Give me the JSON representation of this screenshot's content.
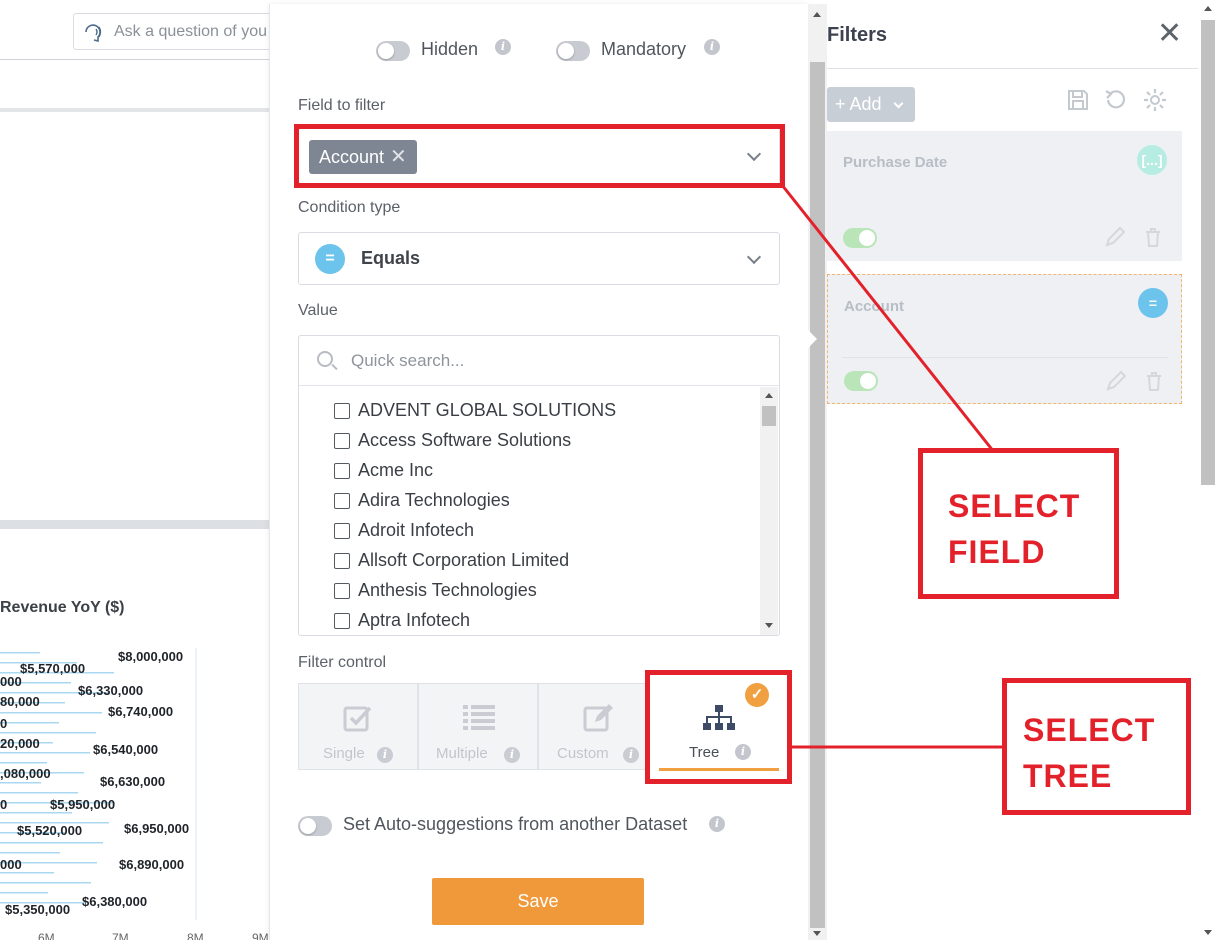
{
  "background": {
    "ask_placeholder": "Ask a question of you",
    "chart_title": "Revenue YoY ($)"
  },
  "chart_data": {
    "type": "bar",
    "title": "Revenue YoY ($)",
    "orientation": "horizontal",
    "data_labels": [
      "$8,000,000",
      "$5,570,000",
      "000",
      "$6,330,000",
      "80,000",
      "$6,740,000",
      "0",
      "20,000",
      "$6,540,000",
      ",080,000",
      "$6,630,000",
      "0",
      "$5,950,000",
      "$5,520,000",
      "$6,950,000",
      "000",
      "$6,890,000",
      "$5,350,000",
      "$6,380,000"
    ],
    "x_ticks": [
      "6M",
      "7M",
      "8M",
      "9M"
    ]
  },
  "panel": {
    "hidden_label": "Hidden",
    "mandatory_label": "Mandatory",
    "field_label": "Field to filter",
    "field_chip": "Account",
    "field_chip_remove": "✕",
    "condition_label": "Condition type",
    "condition_icon": "=",
    "condition_value": "Equals",
    "value_label": "Value",
    "search_placeholder": "Quick search...",
    "accounts": [
      "ADVENT GLOBAL SOLUTIONS",
      "Access Software Solutions",
      "Acme Inc",
      "Adira Technologies",
      "Adroit Infotech",
      "Allsoft Corporation Limited",
      "Anthesis Technologies",
      "Aptra Infotech"
    ],
    "filter_control_label": "Filter control",
    "controls": {
      "single": "Single",
      "multiple": "Multiple",
      "custom": "Custom",
      "tree": "Tree"
    },
    "selected_control": "Tree",
    "autosuggest_label": "Set Auto-suggestions from another Dataset",
    "save_label": "Save",
    "info_glyph": "i"
  },
  "filters": {
    "title": "Filters",
    "close": "✕",
    "add_label": "+ Add",
    "cards": [
      {
        "title": "Purchase Date",
        "badge": "[...]",
        "badge_color": "#b7ece2"
      },
      {
        "title": "Account",
        "badge": "=",
        "badge_color": "#6cc3ec"
      }
    ]
  },
  "annotations": {
    "select_field_line1": "SELECT",
    "select_field_line2": "FIELD",
    "select_tree_line1": "SELECT",
    "select_tree_line2": "TREE",
    "color": "#e3212b"
  },
  "colors": {
    "accent_orange": "#f0993a",
    "chip_gray": "#7d8692",
    "eq_blue": "#6cc3ec"
  }
}
